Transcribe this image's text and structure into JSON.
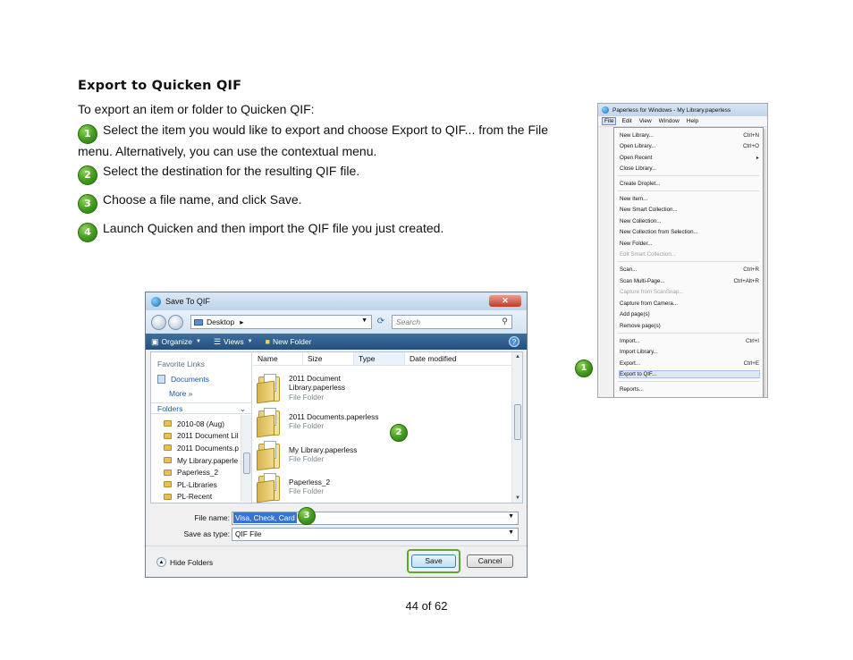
{
  "doc": {
    "title": "Export to Quicken QIF",
    "intro": "To export an item or folder to Quicken QIF:",
    "steps": [
      {
        "num": "1",
        "text": "Select the item you would like to export and choose Export to QIF... from the File menu. Alternatively, you can use the contextual menu."
      },
      {
        "num": "2",
        "text": "Select the destination for the resulting QIF file."
      },
      {
        "num": "3",
        "text": "Choose a file name, and click Save."
      },
      {
        "num": "4",
        "text": "Launch Quicken and then import the QIF file you just created."
      }
    ],
    "page": "44 of 62"
  },
  "dialog": {
    "title": "Save To QIF",
    "close": "✕",
    "address": "Desktop",
    "address_arrow": "▸",
    "search_placeholder": "Search",
    "toolbar": {
      "organize": "Organize",
      "views": "Views",
      "new_folder": "New Folder",
      "help": "?"
    },
    "favorites_heading": "Favorite Links",
    "favorites": {
      "documents": "Documents",
      "more": "More  »"
    },
    "folders_heading": "Folders",
    "folders": [
      "2010-08 (Aug)",
      "2011 Document Lil",
      "2011 Documents.p",
      "My Library.paperle",
      "Paperless_2",
      "PL-Libraries",
      "PL-Recent"
    ],
    "columns": [
      "Name",
      "Size",
      "Type",
      "Date modified"
    ],
    "files": [
      {
        "name": "2011 Document Library.paperless",
        "type": "File Folder"
      },
      {
        "name": "2011 Documents.paperless",
        "type": "File Folder"
      },
      {
        "name": "My Library.paperless",
        "type": "File Folder"
      },
      {
        "name": "Paperless_2",
        "type": "File Folder"
      }
    ],
    "file_name_label": "File name:",
    "file_name_value": "Visa, Check, Card",
    "save_type_label": "Save as type:",
    "save_type_value": "QIF File",
    "hide_folders": "Hide Folders",
    "save_button": "Save",
    "cancel_button": "Cancel"
  },
  "menu": {
    "window_title": "Paperless for Windows - My Library.paperless",
    "bar": [
      "File",
      "Edit",
      "View",
      "Window",
      "Help"
    ],
    "items": [
      {
        "label": "New Library...",
        "shortcut": "Ctrl+N"
      },
      {
        "label": "Open Library...",
        "shortcut": "Ctrl+O"
      },
      {
        "label": "Open Recent",
        "shortcut": "▸"
      },
      {
        "label": "Close Library...",
        "shortcut": ""
      },
      {
        "label": "Create Droplet...",
        "shortcut": ""
      },
      {
        "label": "New Item...",
        "shortcut": ""
      },
      {
        "label": "New Smart Collection...",
        "shortcut": ""
      },
      {
        "label": "New Collection...",
        "shortcut": ""
      },
      {
        "label": "New Collection from Selection...",
        "shortcut": ""
      },
      {
        "label": "New Folder...",
        "shortcut": ""
      },
      {
        "label": "Edit Smart Collection...",
        "shortcut": ""
      },
      {
        "label": "Scan...",
        "shortcut": "Ctrl+R"
      },
      {
        "label": "Scan Multi-Page...",
        "shortcut": "Ctrl+Alt+R"
      },
      {
        "label": "Capture from ScanSnap...",
        "shortcut": ""
      },
      {
        "label": "Capture from Camera...",
        "shortcut": ""
      },
      {
        "label": "Add page(s)",
        "shortcut": ""
      },
      {
        "label": "Remove page(s)",
        "shortcut": ""
      },
      {
        "label": "Import...",
        "shortcut": "Ctrl+I"
      },
      {
        "label": "Import Library...",
        "shortcut": ""
      },
      {
        "label": "Export...",
        "shortcut": "Ctrl+E"
      },
      {
        "label": "Export to QIF...",
        "shortcut": ""
      },
      {
        "label": "Reports...",
        "shortcut": ""
      }
    ]
  },
  "callouts": {
    "menu": "1",
    "destination": "2",
    "filename": "3"
  },
  "colors": {
    "badge_green": "#3f9a1d",
    "highlight_green": "#5aaa2d",
    "toolbar_blue": "#24507f"
  }
}
